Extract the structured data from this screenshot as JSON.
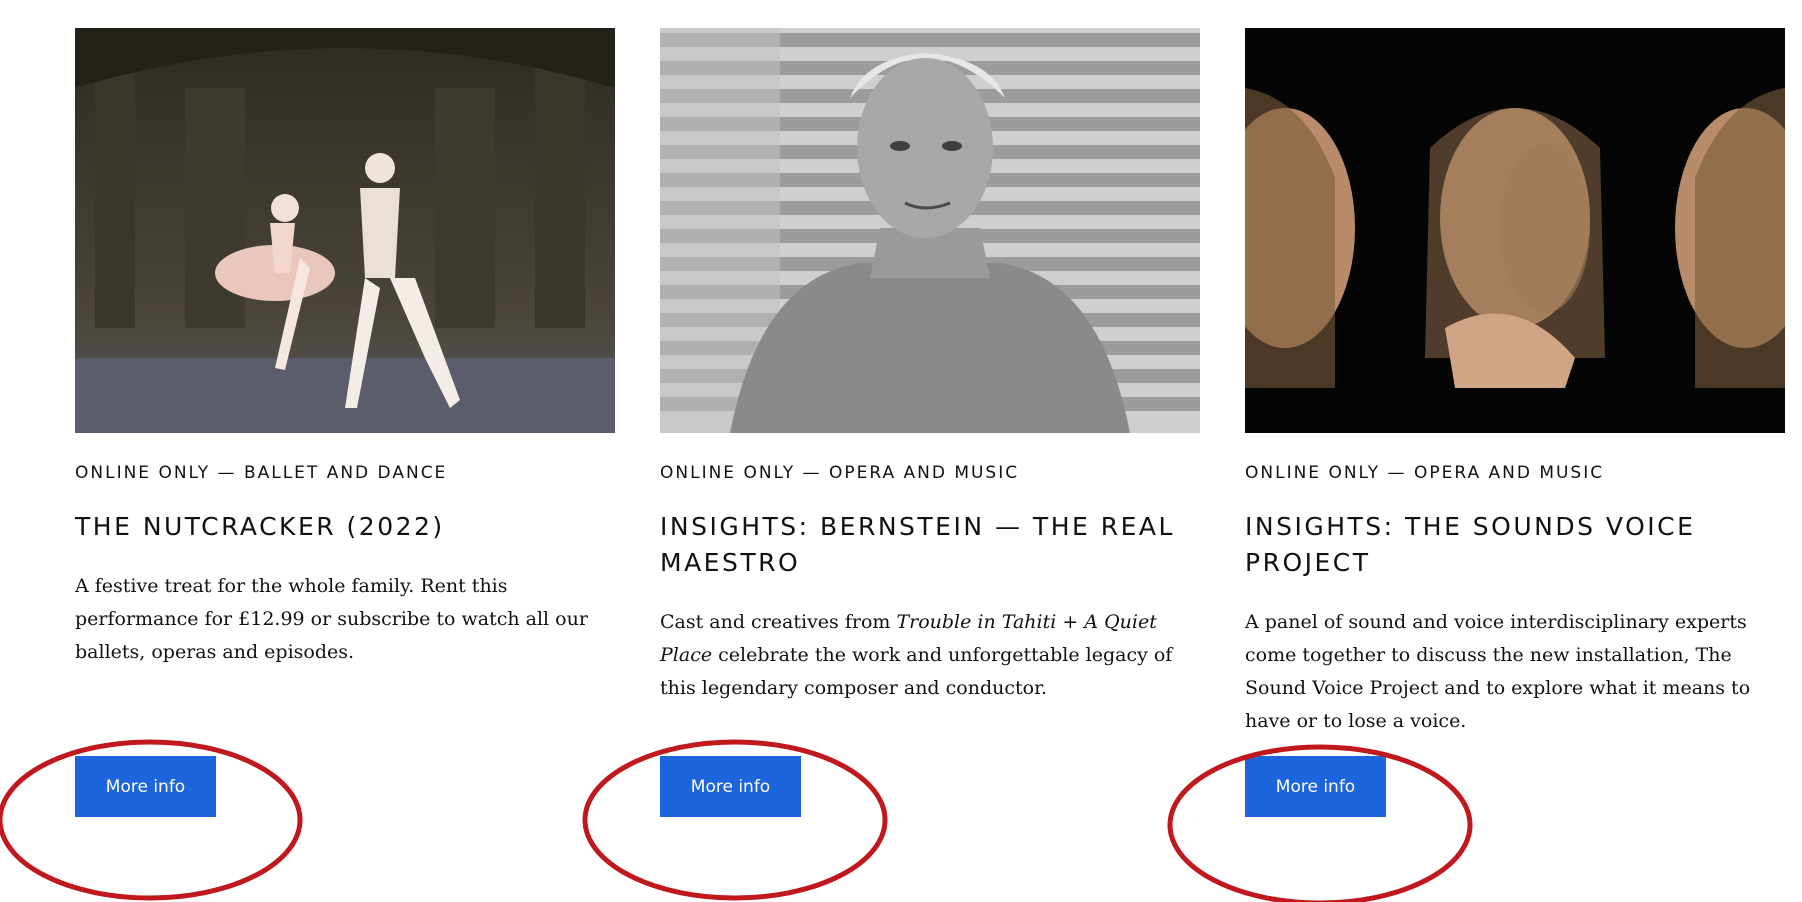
{
  "cards": [
    {
      "image_alt": "ballet dancers on stage",
      "category": "ONLINE ONLY — BALLET AND DANCE",
      "title": "THE NUTCRACKER (2022)",
      "description": "A festive treat for the whole family. Rent this performance for £12.99 or subscribe to watch all our ballets, operas and episodes.",
      "button_label": "More info"
    },
    {
      "image_alt": "black and white portrait of a man in a turtleneck",
      "category": "ONLINE ONLY — OPERA AND MUSIC",
      "title": "INSIGHTS: BERNSTEIN — THE REAL MAESTRO",
      "description_prefix": "Cast and creatives from ",
      "description_italic": "Trouble in Tahiti + A Quiet Place",
      "description_suffix": " celebrate the work and unforgettable legacy of this legendary composer and conductor.",
      "button_label": "More info"
    },
    {
      "image_alt": "mirrored faces of a woman on black background",
      "category": "ONLINE ONLY — OPERA AND MUSIC",
      "title": "INSIGHTS: THE SOUNDS VOICE PROJECT",
      "description": "A panel of sound and voice interdisciplinary experts come together to discuss the new installation, The Sound Voice Project and to explore what it means to have or to lose a voice.",
      "button_label": "More info"
    }
  ],
  "colors": {
    "button_bg": "#1d65dd",
    "annotation_circle": "#c0181d"
  }
}
